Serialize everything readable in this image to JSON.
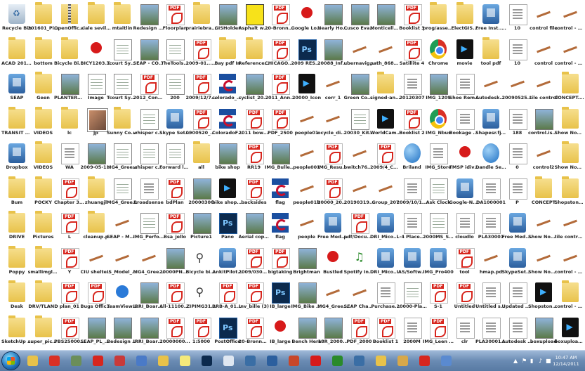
{
  "desktop": {
    "rows": [
      [
        {
          "label": "Recycle Bin",
          "icon": "bin"
        },
        {
          "label": "201601_Pics",
          "icon": "folder"
        },
        {
          "label": "OpenOffice 3.3 (en-US) I...",
          "icon": "zip"
        },
        {
          "label": "viale sevilla tra...4.29",
          "icon": "folder"
        },
        {
          "label": "mtaitlin",
          "icon": "folder"
        },
        {
          "label": "Redesign of CONCEPT...",
          "icon": "img"
        },
        {
          "label": "Floorplan",
          "icon": "pdf"
        },
        {
          "label": "prairiebrac...",
          "icon": "folder"
        },
        {
          "label": "GISHolder",
          "icon": "img"
        },
        {
          "label": "Asphalt with yellow stripe",
          "icon": "yellow"
        },
        {
          "label": "20-Bronne...",
          "icon": "pdf"
        },
        {
          "label": "Google Logo",
          "icon": "red"
        },
        {
          "label": "Nearly Home",
          "icon": "img"
        },
        {
          "label": "Cusco Evangelic",
          "icon": "img"
        },
        {
          "label": "Monticello Recedence...",
          "icon": "img"
        },
        {
          "label": "Booklist 3",
          "icon": "pdf"
        },
        {
          "label": "prog/assets...",
          "icon": "folder"
        },
        {
          "label": "ElectGIS...",
          "icon": "folder"
        },
        {
          "label": "Free Inst... (2)",
          "icon": "app"
        },
        {
          "label": "10",
          "icon": "doc"
        },
        {
          "label": "control file",
          "icon": "tool"
        },
        {
          "label": "control - Copy file",
          "icon": "tool"
        }
      ],
      [
        {
          "label": "ACAD 2010/ 2006 Rev...",
          "icon": "folder"
        },
        {
          "label": "bottom",
          "icon": "folder"
        },
        {
          "label": "Bicycle Bike Reference...",
          "icon": "folder"
        },
        {
          "label": "BICY1203... A34c_...",
          "icon": "red"
        },
        {
          "label": "Tcourt Sym 2_Backup...",
          "icon": "sheet"
        },
        {
          "label": "SEAP - CONCEPT...",
          "icon": "img"
        },
        {
          "label": "TheTools...",
          "icon": "sheet"
        },
        {
          "label": "2009-01... Resilience...",
          "icon": "pdf"
        },
        {
          "label": "Bay pdf In",
          "icon": "folder"
        },
        {
          "label": "Reference...",
          "icon": "folder"
        },
        {
          "label": "CHICAGO... Maerial",
          "icon": "pdf"
        },
        {
          "label": "2009 RESTRT",
          "icon": "ps"
        },
        {
          "label": "20088_Info Looking(1)",
          "icon": "img"
        },
        {
          "label": "ubernavigator...",
          "icon": "tool"
        },
        {
          "label": "path_8682...",
          "icon": "tool"
        },
        {
          "label": "Satillite 4",
          "icon": "pdf"
        },
        {
          "label": "Chrome",
          "icon": "chrome"
        },
        {
          "label": "movie",
          "icon": "media"
        },
        {
          "label": "tool pdf",
          "icon": "folder"
        },
        {
          "label": "10",
          "icon": "doc"
        },
        {
          "label": "control",
          "icon": "tool"
        },
        {
          "label": "control - Copy",
          "icon": "tool"
        }
      ],
      [
        {
          "label": "SEAP",
          "icon": "app"
        },
        {
          "label": "Geen",
          "icon": "folder"
        },
        {
          "label": "PLANTERS BRAP PLA...",
          "icon": "img"
        },
        {
          "label": "Image",
          "icon": "sheet"
        },
        {
          "label": "Tcourt Sym 2_Backup 3",
          "icon": "sheet"
        },
        {
          "label": "2012_Con... - 20120202...",
          "icon": "pdf"
        },
        {
          "label": "200",
          "icon": "sheet"
        },
        {
          "label": "2009/12/7 19... Roadmap...",
          "icon": "pdf"
        },
        {
          "label": "colorado_flag",
          "icon": "flag"
        },
        {
          "label": "cyclist_2011",
          "icon": "img"
        },
        {
          "label": "2011_Ann...",
          "icon": "pdf"
        },
        {
          "label": "20000_Icon",
          "icon": "media"
        },
        {
          "label": "corr_1",
          "icon": "tool"
        },
        {
          "label": "Green Comp",
          "icon": "img"
        },
        {
          "label": "signed-and...",
          "icon": "folder"
        },
        {
          "label": "20120307",
          "icon": "doc"
        },
        {
          "label": "IMG_1209",
          "icon": "img"
        },
        {
          "label": "Shoe Removed",
          "icon": "doc"
        },
        {
          "label": "Autodesk_2d",
          "icon": "tool"
        },
        {
          "label": "2009052501",
          "icon": "tool"
        },
        {
          "label": "tile control",
          "icon": "tool"
        },
        {
          "label": "CONCEPT... - Copy",
          "icon": "folder"
        }
      ],
      [
        {
          "label": "TRANSIT PARKING",
          "icon": "folder"
        },
        {
          "label": "VIDEOS",
          "icon": "folder"
        },
        {
          "label": "lc",
          "icon": "folder"
        },
        {
          "label": "jp",
          "icon": "photo"
        },
        {
          "label": "Sunny Cornell",
          "icon": "folder"
        },
        {
          "label": "whisper cheesebrik",
          "icon": "sheet"
        },
        {
          "label": "Skype Setup",
          "icon": "app"
        },
        {
          "label": "0900520_R... Roadmap...",
          "icon": "pdf"
        },
        {
          "label": "ColoradoFlag",
          "icon": "flag"
        },
        {
          "label": "2011 bowland 4-1",
          "icon": "pdf"
        },
        {
          "label": "PDF_2500",
          "icon": "pdf"
        },
        {
          "label": "people01",
          "icon": "tool"
        },
        {
          "label": "ocycle_diagr...",
          "icon": "tool"
        },
        {
          "label": "20030_Kite Tutorial",
          "icon": "sheet"
        },
        {
          "label": "WorldCamera",
          "icon": "media"
        },
        {
          "label": "Booklist 2",
          "icon": "pdf"
        },
        {
          "label": "IMG_Nbus",
          "icon": "chrome"
        },
        {
          "label": "Bookage whiteboard",
          "icon": "doc"
        },
        {
          "label": "Shapesr.fjk...",
          "icon": "app"
        },
        {
          "label": "188",
          "icon": "doc"
        },
        {
          "label": "control.iso.Sk...",
          "icon": "img"
        },
        {
          "label": "Show Now Go Up - ...",
          "icon": "folder"
        }
      ],
      [
        {
          "label": "Dropbox",
          "icon": "app"
        },
        {
          "label": "VIDEOS",
          "icon": "folder"
        },
        {
          "label": "WA",
          "icon": "doc"
        },
        {
          "label": "2009-05-18...",
          "icon": "img"
        },
        {
          "label": "MG4_Green... - Whisper C...",
          "icon": "sheet"
        },
        {
          "label": "whisper cheesel",
          "icon": "sheet"
        },
        {
          "label": "Forward lo...",
          "icon": "sheet"
        },
        {
          "label": "all",
          "icon": "folder"
        },
        {
          "label": "bike shop",
          "icon": "img"
        },
        {
          "label": "RR19",
          "icon": "pdf"
        },
        {
          "label": "IMG_Bulleti...",
          "icon": "img"
        },
        {
          "label": "people001",
          "icon": "tool"
        },
        {
          "label": "IMG_Results...",
          "icon": "pdf"
        },
        {
          "label": "bwitch769...",
          "icon": "tool"
        },
        {
          "label": "2009/4_Ch... 3 - Her Desi...",
          "icon": "pdf"
        },
        {
          "label": "Briland",
          "icon": "globe"
        },
        {
          "label": "IMG_Store",
          "icon": "doc"
        },
        {
          "label": "TMSP idiv(1)...",
          "icon": "red"
        },
        {
          "label": "Dandle Setup ISBN",
          "icon": "globe"
        },
        {
          "label": "0",
          "icon": "doc"
        },
        {
          "label": "control2",
          "icon": "tool"
        },
        {
          "label": "Show Now Go Up - ...",
          "icon": "folder"
        }
      ],
      [
        {
          "label": "Bum",
          "icon": "folder"
        },
        {
          "label": "POCKY",
          "icon": "folder"
        },
        {
          "label": "Chapter 3 - the Prefers...",
          "icon": "pdf"
        },
        {
          "label": "zhuangjl",
          "icon": "folder"
        },
        {
          "label": "MG4_Green... - Shift 7",
          "icon": "sheet"
        },
        {
          "label": "Broadsense",
          "icon": "doc"
        },
        {
          "label": "bdPlan",
          "icon": "pdf"
        },
        {
          "label": "20000300",
          "icon": "img"
        },
        {
          "label": "bike shop mask",
          "icon": "media"
        },
        {
          "label": "backsides",
          "icon": "pdf"
        },
        {
          "label": "flag",
          "icon": "flag"
        },
        {
          "label": "people01b",
          "icon": "tool"
        },
        {
          "label": "20000_2000 landmark...",
          "icon": "pdf"
        },
        {
          "label": "20190319...",
          "icon": "tool"
        },
        {
          "label": "Group_207",
          "icon": "tool"
        },
        {
          "label": "2009/10/16...",
          "icon": "doc"
        },
        {
          "label": "Ask Clock",
          "icon": "sheet"
        },
        {
          "label": "Google-Ne...",
          "icon": "app"
        },
        {
          "label": "DA1000001",
          "icon": "doc"
        },
        {
          "label": "P",
          "icon": "doc"
        },
        {
          "label": "CONCEPT",
          "icon": "folder"
        },
        {
          "label": "Shopstone... - Copy",
          "icon": "folder"
        }
      ],
      [
        {
          "label": "DRIVE",
          "icon": "folder"
        },
        {
          "label": "Pictures",
          "icon": "folder"
        },
        {
          "label": "L",
          "icon": "pdf"
        },
        {
          "label": "cleanup.p",
          "icon": "folder"
        },
        {
          "label": "SEAP - MG4_Green...",
          "icon": "tool"
        },
        {
          "label": "IMG_Perfor... (1)",
          "icon": "sheet"
        },
        {
          "label": "Bsa_jello",
          "icon": "pdf"
        },
        {
          "label": "Picture1",
          "icon": "img"
        },
        {
          "label": "Pano",
          "icon": "ps"
        },
        {
          "label": "Aerial copy sandP",
          "icon": "img"
        },
        {
          "label": "flag",
          "icon": "flag"
        },
        {
          "label": "people",
          "icon": "tool"
        },
        {
          "label": "Free Med... (1)",
          "icon": "app"
        },
        {
          "label": "pdf/Docume...",
          "icon": "pdf"
        },
        {
          "label": "DRI_Micoh... Residence",
          "icon": "app"
        },
        {
          "label": "L-4 Placemadio",
          "icon": "doc"
        },
        {
          "label": "2000MS_Sun Ryle Rey",
          "icon": "sheet"
        },
        {
          "label": "cloudlo",
          "icon": "doc"
        },
        {
          "label": "PLA30001",
          "icon": "doc"
        },
        {
          "label": "Free Med... (1)",
          "icon": "app"
        },
        {
          "label": "Show Now Go Up-Ele",
          "icon": "tool"
        },
        {
          "label": "tile control - Copy",
          "icon": "tool"
        }
      ],
      [
        {
          "label": "Poppy",
          "icon": "folder"
        },
        {
          "label": "smallimglin...",
          "icon": "folder"
        },
        {
          "label": "Y",
          "icon": "pdf"
        },
        {
          "label": "CIU shelters",
          "icon": "tool"
        },
        {
          "label": "IS_Model_P...",
          "icon": "tool"
        },
        {
          "label": "MG4_Green... DA_Kak_101...",
          "icon": "tool"
        },
        {
          "label": "20000PNG...",
          "icon": "img"
        },
        {
          "label": "Bicycle bike cycle cycling",
          "icon": "bike"
        },
        {
          "label": "AnkitPilot...",
          "icon": "app"
        },
        {
          "label": "2009/0301... bsnoloject...",
          "icon": "pdf"
        },
        {
          "label": "bigtaking",
          "icon": "pdf"
        },
        {
          "label": "Brightman",
          "icon": "img"
        },
        {
          "label": "Bustled",
          "icon": "red"
        },
        {
          "label": "Spotify Installer",
          "icon": "audio"
        },
        {
          "label": "DRI_Micoh... Residence",
          "icon": "app"
        },
        {
          "label": "IAS/Software... Tutorial",
          "icon": "app"
        },
        {
          "label": "IMG_Pro400",
          "icon": "app"
        },
        {
          "label": "tool",
          "icon": "pdf"
        },
        {
          "label": "hmap.pd",
          "icon": "tool"
        },
        {
          "label": "SkypeSetup (2)",
          "icon": "app"
        },
        {
          "label": "Show Now Go Up",
          "icon": "tool"
        },
        {
          "label": "control - Copy",
          "icon": "tool"
        }
      ],
      [
        {
          "label": "Desk",
          "icon": "folder"
        },
        {
          "label": "DRV/TLAND",
          "icon": "folder"
        },
        {
          "label": "plan_01",
          "icon": "pdf"
        },
        {
          "label": "Bugs Offic...",
          "icon": "pdf"
        },
        {
          "label": "TeamViewer",
          "icon": "blue"
        },
        {
          "label": "IRRI_Board Renew W...",
          "icon": "img"
        },
        {
          "label": "All-1110000 W_HS",
          "icon": "pdf"
        },
        {
          "label": "ZIPIMG31...",
          "icon": "bike"
        },
        {
          "label": "BRB-A_0100...",
          "icon": "pdf"
        },
        {
          "label": "Inv_bille (3)",
          "icon": "pdf"
        },
        {
          "label": "IB_large",
          "icon": "ps"
        },
        {
          "label": "IMG_Bike Shop",
          "icon": "img"
        },
        {
          "label": "MG4_Green... - FINISH II",
          "icon": "tool"
        },
        {
          "label": "SEAP Cham... - FINISH II",
          "icon": "tool"
        },
        {
          "label": "Purchase...",
          "icon": "doc"
        },
        {
          "label": "20000-Plat...",
          "icon": "sheet"
        },
        {
          "label": "S-1",
          "icon": "pdf"
        },
        {
          "label": "Untitled",
          "icon": "pdf"
        },
        {
          "label": "Untitled specialities...",
          "icon": "doc"
        },
        {
          "label": "Updated Show Bas...",
          "icon": "doc"
        },
        {
          "label": "Shopstone...",
          "icon": "media"
        },
        {
          "label": "control - Copy-ele",
          "icon": "folder"
        }
      ],
      [
        {
          "label": "SketchUp Advance...",
          "icon": "folder"
        },
        {
          "label": "super_picture",
          "icon": "folder"
        },
        {
          "label": "PBS25000... - Interior",
          "icon": "pdf"
        },
        {
          "label": "SEAP_PL_Plan",
          "icon": "img"
        },
        {
          "label": "Redesign of SEAP - Gr...",
          "icon": "img"
        },
        {
          "label": "IRRI_Board Renew W...",
          "icon": "img"
        },
        {
          "label": "20000000...",
          "icon": "pdf"
        },
        {
          "label": "1:5000",
          "icon": "pdf"
        },
        {
          "label": "PostOffice",
          "icon": "ps"
        },
        {
          "label": "20-Bronne...",
          "icon": "pdf"
        },
        {
          "label": "IB_large",
          "icon": "red"
        },
        {
          "label": "Bench Here",
          "icon": "img"
        },
        {
          "label": "18R_2000...",
          "icon": "img"
        },
        {
          "label": "PDF_2000",
          "icon": "pdf"
        },
        {
          "label": "Booklist 1",
          "icon": "pdf"
        },
        {
          "label": "2000M",
          "icon": "doc"
        },
        {
          "label": "IMG_Leen Ponderosa P...",
          "icon": "pdf"
        },
        {
          "label": "clr",
          "icon": "doc"
        },
        {
          "label": "PLA30001 POINT",
          "icon": "doc"
        },
        {
          "label": "Autodesk Show Save...",
          "icon": "doc"
        },
        {
          "label": "boxupload",
          "icon": "img"
        },
        {
          "label": "boxupload - Copy",
          "icon": "media"
        }
      ]
    ]
  },
  "taskbar": {
    "start_label": "Start",
    "pinned": [
      {
        "name": "explorer-icon",
        "color": "#e8c24a"
      },
      {
        "name": "chrome-icon",
        "color": "#d93025"
      },
      {
        "name": "photo-viewer-icon",
        "color": "#6b8e5a"
      },
      {
        "name": "acrobat-icon",
        "color": "#d7261e"
      },
      {
        "name": "paint-icon",
        "color": "#c93a3a"
      },
      {
        "name": "network-icon",
        "color": "#4a7ac7"
      },
      {
        "name": "file-manager-icon",
        "color": "#e8c24a"
      },
      {
        "name": "sticky-notes-icon",
        "color": "#f4e97a"
      },
      {
        "name": "photoshop-icon",
        "color": "#0c2a4d"
      },
      {
        "name": "pan-tool-icon",
        "color": "#dfe7f1"
      },
      {
        "name": "autodesk-icon",
        "color": "#3a6ea5"
      },
      {
        "name": "media-library-icon",
        "color": "#2c5f9e"
      },
      {
        "name": "powerpoint-icon",
        "color": "#c8472a"
      },
      {
        "name": "record-icon",
        "color": "#d71a1a"
      },
      {
        "name": "spotify-icon",
        "color": "#2a8a2a"
      },
      {
        "name": "sketchup-icon",
        "color": "#3a6ea5"
      },
      {
        "name": "notepad-icon",
        "color": "#e8c24a"
      },
      {
        "name": "photos-icon",
        "color": "#d7a84a"
      },
      {
        "name": "reader-icon",
        "color": "#d7261e"
      },
      {
        "name": "windows-media-icon",
        "color": "#5a8ad0"
      }
    ],
    "clock_time": "10:47 AM",
    "clock_date": "12/14/2011"
  }
}
